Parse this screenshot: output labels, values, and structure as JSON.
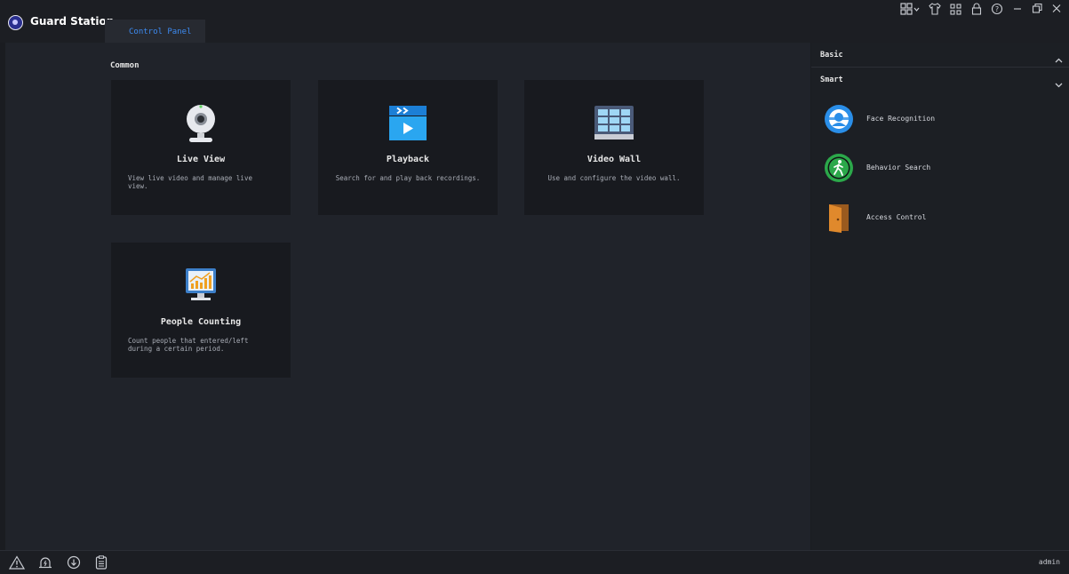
{
  "app": {
    "title": "Guard Station"
  },
  "tabs": [
    {
      "label": "Control Panel",
      "active": true
    }
  ],
  "window_controls": [
    "layout-grid-icon",
    "shirt-icon",
    "network-icon",
    "lock-icon",
    "help-icon",
    "minimize-icon",
    "restore-icon",
    "close-icon"
  ],
  "main": {
    "section_title": "Common",
    "cards": [
      {
        "title": "Live View",
        "description": "View live video and manage live view.",
        "icon": "webcam-icon"
      },
      {
        "title": "Playback",
        "description": "Search for and play back recordings.",
        "icon": "playback-icon"
      },
      {
        "title": "Video Wall",
        "description": "Use and configure the video wall.",
        "icon": "video-wall-icon"
      },
      {
        "title": "People Counting",
        "description": "Count people that entered/left during a certain period.",
        "icon": "people-counting-icon"
      }
    ]
  },
  "right_panel": {
    "basic_label": "Basic",
    "smart_label": "Smart",
    "smart_items": [
      {
        "label": "Face Recognition",
        "icon": "face-recognition-icon"
      },
      {
        "label": "Behavior Search",
        "icon": "behavior-search-icon"
      },
      {
        "label": "Access Control",
        "icon": "access-control-icon"
      }
    ]
  },
  "statusbar": {
    "icons": [
      "alarm-warning-icon",
      "alarm-bell-icon",
      "download-icon",
      "clipboard-icon"
    ],
    "user": "admin"
  },
  "colors": {
    "accent": "#3d8bf2",
    "background": "#1a1c21",
    "card": "#181a1f"
  }
}
